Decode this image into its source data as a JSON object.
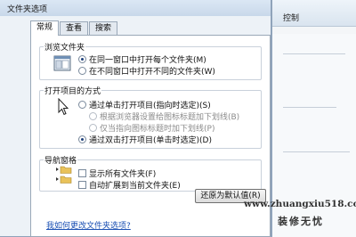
{
  "dialog": {
    "title": "文件夹选项",
    "tabs": [
      {
        "label": "常规",
        "active": true
      },
      {
        "label": "查看",
        "active": false
      },
      {
        "label": "搜索",
        "active": false
      }
    ]
  },
  "background": {
    "partial_text": "控制"
  },
  "browse_folders": {
    "legend": "浏览文件夹",
    "options": [
      {
        "label": "在同一窗口中打开每个文件夹(M)",
        "selected": true
      },
      {
        "label": "在不同窗口中打开不同的文件夹(W)",
        "selected": false
      }
    ]
  },
  "open_items": {
    "legend": "打开项目的方式",
    "options": [
      {
        "label": "通过单击打开项目(指向时选定)(S)",
        "selected": false,
        "enabled": true
      },
      {
        "label": "根据浏览器设置给图标标题加下划线(B)",
        "selected": false,
        "enabled": false
      },
      {
        "label": "仅当指向图标标题时加下划线(P)",
        "selected": false,
        "enabled": false
      },
      {
        "label": "通过双击打开项目(单击时选定)(D)",
        "selected": true,
        "enabled": true
      }
    ]
  },
  "nav_pane": {
    "legend": "导航窗格",
    "options": [
      {
        "label": "显示所有文件夹(F)",
        "checked": false
      },
      {
        "label": "自动扩展到当前文件夹(E)",
        "checked": false
      }
    ]
  },
  "buttons": {
    "restore_defaults": "还原为默认值(R)"
  },
  "links": {
    "help": "我如何更改文件夹选项?"
  },
  "watermark": {
    "url": "www.zhuangxiu518.com",
    "text": "装修无忧"
  },
  "icons": [
    "folder-window-icon",
    "cursor-click-icon",
    "folder-tree-icon"
  ]
}
